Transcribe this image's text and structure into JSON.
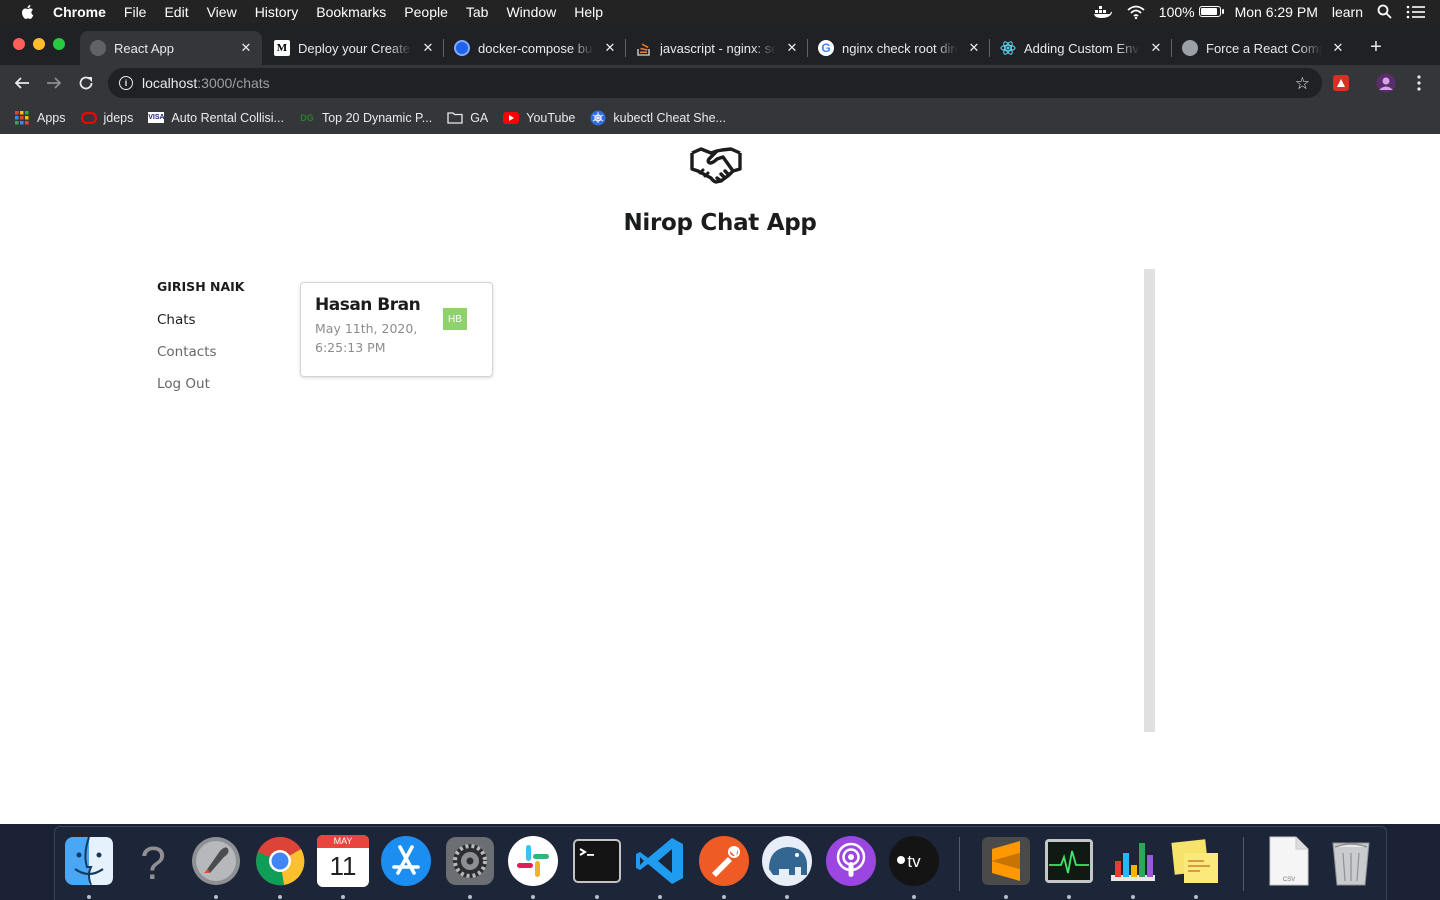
{
  "menubar": {
    "app_name": "Chrome",
    "items": [
      "File",
      "Edit",
      "View",
      "History",
      "Bookmarks",
      "People",
      "Tab",
      "Window",
      "Help"
    ],
    "battery": "100%",
    "battery_level": 1.0,
    "clock": "Mon 6:29 PM",
    "user": "learn"
  },
  "tabs": [
    {
      "title": "React App",
      "icon": "react-app-favicon",
      "active": true
    },
    {
      "title": "Deploy your Create React App",
      "icon": "medium-favicon",
      "active": false
    },
    {
      "title": "docker-compose build",
      "icon": "docker-favicon",
      "active": false
    },
    {
      "title": "javascript - nginx: serve",
      "icon": "stackoverflow-favicon",
      "active": false
    },
    {
      "title": "nginx check root directory",
      "icon": "google-favicon",
      "active": false
    },
    {
      "title": "Adding Custom Environment",
      "icon": "react-favicon",
      "active": false
    },
    {
      "title": "Force a React Component",
      "icon": "blog-favicon",
      "active": false
    }
  ],
  "address": {
    "host": "localhost",
    "path": ":3000/chats"
  },
  "bookmarks": [
    {
      "label": "Apps",
      "icon": "apps-grid-icon"
    },
    {
      "label": "jdeps",
      "icon": "oracle-icon"
    },
    {
      "label": "Auto Rental Collisi...",
      "icon": "visa-icon"
    },
    {
      "label": "Top 20 Dynamic P...",
      "icon": "dg-icon"
    },
    {
      "label": "GA",
      "icon": "folder-icon"
    },
    {
      "label": "YouTube",
      "icon": "youtube-icon"
    },
    {
      "label": "kubectl Cheat She...",
      "icon": "kubernetes-icon"
    }
  ],
  "page": {
    "title": "Nirop Chat App",
    "user_name": "GIRISH NAIK",
    "nav": {
      "chats": "Chats",
      "contacts": "Contacts",
      "logout": "Log Out"
    },
    "chats": [
      {
        "name": "Hasan Bran",
        "timestamp": "May 11th, 2020, 6:25:13 PM",
        "initials": "HB",
        "avatar_color": "#8ed16d"
      }
    ]
  },
  "dock": {
    "calendar_month": "MAY",
    "calendar_day": "11",
    "apps": [
      "finder-icon",
      "help-icon",
      "launchpad-icon",
      "chrome-icon",
      "calendar-icon",
      "app-store-icon",
      "system-preferences-icon",
      "slack-icon",
      "terminal-icon",
      "vscode-icon",
      "postman-icon",
      "postgres-icon",
      "podcasts-icon",
      "apple-tv-icon",
      "sublime-text-icon",
      "activity-monitor-icon",
      "numbers-icon",
      "stickies-icon",
      "csv-file-icon",
      "trash-icon"
    ]
  }
}
